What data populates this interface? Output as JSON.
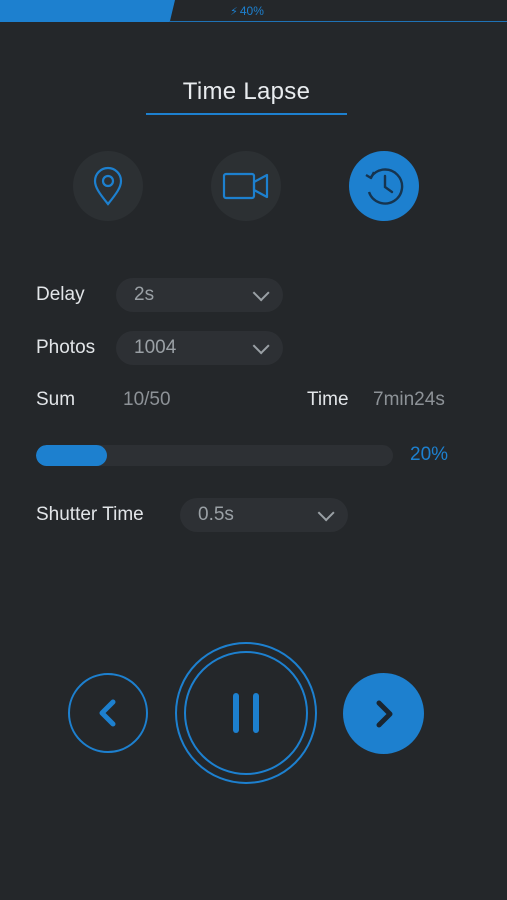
{
  "status": {
    "battery": "40%",
    "battery_icon": "lightning-icon"
  },
  "header": {
    "title": "Time Lapse"
  },
  "modes": [
    {
      "name": "location",
      "icon": "location-pin-icon",
      "active": false
    },
    {
      "name": "video",
      "icon": "video-camera-icon",
      "active": false
    },
    {
      "name": "timelapse",
      "icon": "clock-history-icon",
      "active": true
    }
  ],
  "settings": {
    "delay": {
      "label": "Delay",
      "value": "2s"
    },
    "photos": {
      "label": "Photos",
      "value": "1004"
    },
    "sum": {
      "label": "Sum",
      "value": "10/50"
    },
    "time": {
      "label": "Time",
      "value": "7min24s"
    },
    "progress": {
      "value": 0.2,
      "text": "20%"
    },
    "shutter": {
      "label": "Shutter Time",
      "value": "0.5s"
    }
  },
  "controls": {
    "prev_icon": "chevron-left-icon",
    "pause_icon": "pause-icon",
    "next_icon": "chevron-right-icon"
  },
  "colors": {
    "accent": "#1d80cf",
    "background": "#24272a",
    "surface": "#2d3034"
  }
}
